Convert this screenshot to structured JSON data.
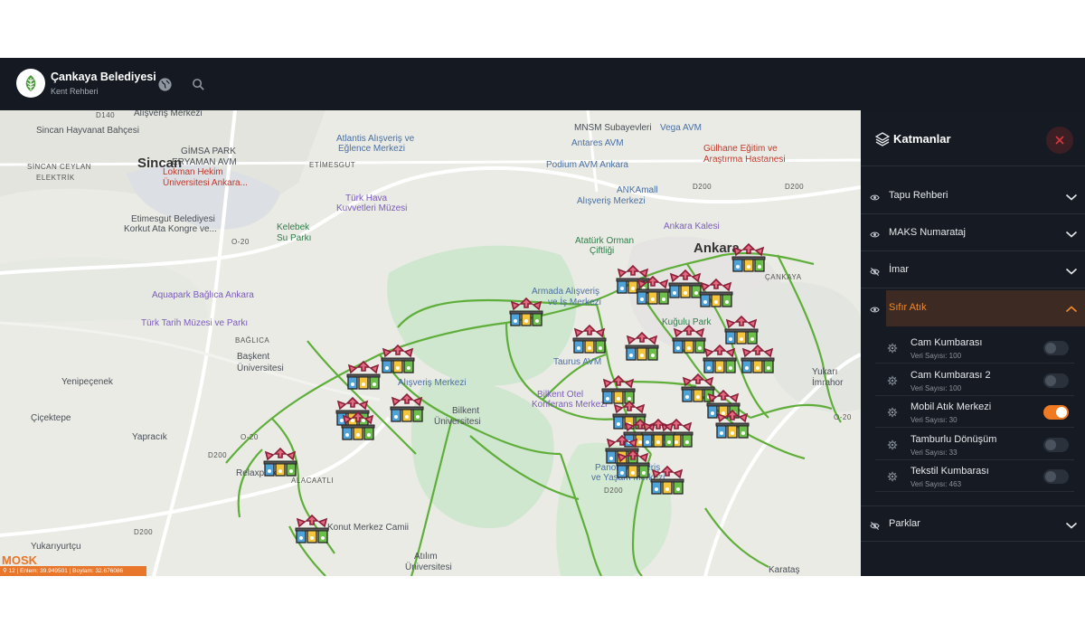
{
  "header": {
    "title": "Çankaya Belediyesi",
    "subtitle": "Kent Rehberi",
    "icons": [
      "leaf-logo",
      "globe-icon",
      "search-icon"
    ]
  },
  "map": {
    "labels": {
      "alisveris_top": "Alışveriş Merkezi",
      "d140": "D140",
      "sincan_hb": "Sincan Hayvanat Bahçesi",
      "gimsa": "GİMSA PARK",
      "eryaman": "ERYAMAN AVM",
      "atlantis": "Atlantis Alışveriş ve",
      "atlantis2": "Eğlence Merkezi",
      "mnsm": "MNSM Subayevleri",
      "vega": "Vega AVM",
      "antares": "Antares AVM",
      "gulhane": "Gülhane Eğitim ve",
      "gulhane2": "Araştırma Hastanesi",
      "sincan": "Sincan",
      "sincan_ceylan": "SİNCAN CEYLAN",
      "elektrik": "ELEKTRİK",
      "lokman": "Lokman Hekim",
      "lokman2": "Üniversitesi Ankara...",
      "etimesgut_caps": "ETİMESGUT",
      "podium": "Podium AVM Ankara",
      "ankamall": "ANKAmall",
      "ankamall2": "Alışveriş Merkezi",
      "d200a": "D200",
      "d200b": "D200",
      "turk_hava": "Türk Hava",
      "turk_hava2": "Kuvvetleri Müzesi",
      "etimesgut_bel": "Etimesgut Belediyesi",
      "etimesgut_bel2": "Korkut Ata Kongre ve...",
      "kelebek": "Kelebek",
      "kelebek2": "Su Parkı",
      "ankara_kalesi": "Ankara Kalesi",
      "ataturk_orman": "Atatürk Orman",
      "ataturk_orman2": "Çiftliği",
      "o20a": "O-20",
      "ankara": "Ankara",
      "cankaya_caps": "ÇANKAYA",
      "aquapark": "Aquapark Bağlıca Ankara",
      "turk_tarih": "Türk Tarih Müzesi ve Parkı",
      "armada": "Armada Alışveriş",
      "armada2": "ve İş Merkezi",
      "kugulu": "Kuğulu Park",
      "baglica": "BAĞLICA",
      "baskent": "Başkent",
      "baskent2": "Üniversitesi",
      "taurus": "Taurus AVM",
      "yenipecenek": "Yenipeçenek",
      "alisveris_mid": "Alışveriş Merkezi",
      "bilkent_otel": "Bilkent Otel",
      "bilkent_otel2": "Konferans Merkezi",
      "bilkent_uni": "Bilkent",
      "bilkent_uni2": "Üniversitesi",
      "yukari_imrahor": "Yukarı",
      "yukari_imrahor2": "İmrahor",
      "cicektepe": "Çiçektepe",
      "yapracik": "Yapracık",
      "o20b": "O-20",
      "o20c": "O-20",
      "d200c": "D200",
      "relaxpark": "Relaxpark",
      "alacaatli": "ALACAATLI",
      "panora": "Panora Alışveriş",
      "panora2": "ve Yaşam Merkezi",
      "d200d": "D200",
      "d200e": "D200",
      "konut": "Konut Merkez Camii",
      "yukariyurtcu": "Yukarıyurtçu",
      "atilim": "Atılım",
      "atilim2": "Üniversitesi",
      "karatas": "Karataş"
    },
    "marker_count": 30,
    "brand_mark": "MOSK",
    "coords_bar": "⚲ 12 | Enlem: 39.949501 | Boylam: 32.676086"
  },
  "panel": {
    "title": "Katmanlar",
    "sections": [
      {
        "label": "Tapu Rehberi",
        "visible": true,
        "expanded": false
      },
      {
        "label": "MAKS Numarataj",
        "visible": true,
        "expanded": false
      },
      {
        "label": "İmar",
        "visible": false,
        "expanded": false
      },
      {
        "label": "Sıfır Atık",
        "visible": true,
        "expanded": true
      },
      {
        "label": "Parklar",
        "visible": false,
        "expanded": false
      }
    ],
    "sublayers": [
      {
        "name": "Cam Kumbarası",
        "count": "Veri Sayısı: 100",
        "enabled": false
      },
      {
        "name": "Cam Kumbarası 2",
        "count": "Veri Sayısı: 100",
        "enabled": false
      },
      {
        "name": "Mobil Atık Merkezi",
        "count": "Veri Sayısı: 30",
        "enabled": true
      },
      {
        "name": "Tamburlu Dönüşüm",
        "count": "Veri Sayısı: 33",
        "enabled": false
      },
      {
        "name": "Tekstil Kumbarası",
        "count": "Veri Sayısı: 463",
        "enabled": false
      }
    ]
  },
  "colors": {
    "topbar": "#151a22",
    "panel": "#161b23",
    "accent": "#ef7a22",
    "road_green": "#5fae3a",
    "close_red": "#d9363e"
  }
}
